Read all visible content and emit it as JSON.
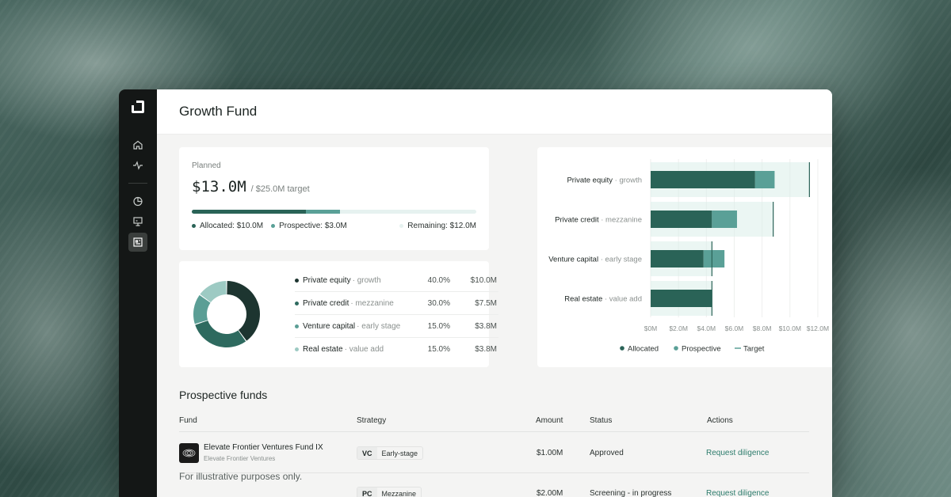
{
  "page": {
    "title": "Growth Fund",
    "disclaimer": "For illustrative purposes only."
  },
  "sidebar": {
    "items": [
      {
        "icon": "home-icon"
      },
      {
        "icon": "activity-icon"
      },
      {
        "icon": "pie-chart-icon"
      },
      {
        "icon": "presentation-icon"
      },
      {
        "icon": "report-icon",
        "active": true
      }
    ]
  },
  "planned": {
    "label": "Planned",
    "amount": "$13.0M",
    "target": "/ $25.0M target",
    "allocated_fraction": 0.4,
    "prospective_fraction": 0.12,
    "legend": {
      "allocated": "Allocated: $10.0M",
      "prospective": "Prospective: $3.0M",
      "remaining": "Remaining: $12.0M"
    }
  },
  "allocation": {
    "rows": [
      {
        "name": "Private equity",
        "sub": "· growth",
        "pct": "40.0%",
        "value": "$10.0M",
        "share": 40,
        "color": "#1d3530"
      },
      {
        "name": "Private credit",
        "sub": "· mezzanine",
        "pct": "30.0%",
        "value": "$7.5M",
        "share": 30,
        "color": "#2e6a5f"
      },
      {
        "name": "Venture capital",
        "sub": "· early stage",
        "pct": "15.0%",
        "value": "$3.8M",
        "share": 15,
        "color": "#5b9e95"
      },
      {
        "name": "Real estate",
        "sub": "· value add",
        "pct": "15.0%",
        "value": "$3.8M",
        "share": 15,
        "color": "#9dcac3"
      }
    ]
  },
  "chart_data": {
    "type": "bar",
    "orientation": "horizontal",
    "stacked": true,
    "categories": [
      {
        "name": "Private equity",
        "sub": "· growth"
      },
      {
        "name": "Private credit",
        "sub": "· mezzanine"
      },
      {
        "name": "Venture capital",
        "sub": "· early stage"
      },
      {
        "name": "Real estate",
        "sub": "· value add"
      }
    ],
    "series": [
      {
        "name": "Allocated",
        "values": [
          7.5,
          4.4,
          3.8,
          4.4
        ],
        "color": "#2a6357"
      },
      {
        "name": "Prospective",
        "values": [
          1.4,
          1.8,
          1.5,
          0
        ],
        "color": "#5aa097"
      }
    ],
    "target": {
      "name": "Target",
      "values": [
        11.4,
        8.8,
        4.4,
        4.4
      ],
      "color": "#dbeeea"
    },
    "xlim": [
      0,
      13.2
    ],
    "xticks": [
      "$0M",
      "$2.0M",
      "$4.0M",
      "$6.0M",
      "$8.0M",
      "$10.0M",
      "$12.0M"
    ],
    "xtick_values": [
      0,
      2,
      4,
      6,
      8,
      10,
      12
    ],
    "grid": true,
    "legend": "bottom",
    "legend_labels": [
      "Allocated",
      "Prospective",
      "Target"
    ]
  },
  "prospective": {
    "title": "Prospective funds",
    "columns": {
      "fund": "Fund",
      "strategy": "Strategy",
      "amount": "Amount",
      "status": "Status",
      "actions": "Actions"
    },
    "rows": [
      {
        "fund": "Elevate Frontier Ventures Fund  IX",
        "manager": "Elevate Frontier Ventures",
        "code": "VC",
        "strategy": "Early-stage",
        "amount": "$1.00M",
        "status": "Approved",
        "action": "Request diligence"
      },
      {
        "fund": "",
        "manager": "",
        "code": "PC",
        "strategy": "Mezzanine",
        "amount": "$2.00M",
        "status": "Screening - in progress",
        "action": "Request diligence"
      }
    ]
  }
}
